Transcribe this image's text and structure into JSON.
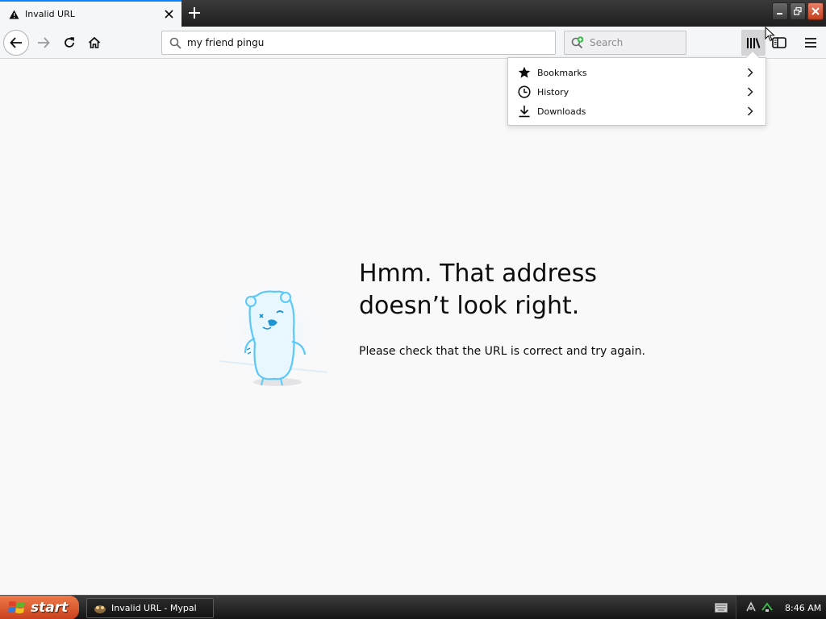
{
  "tab": {
    "title": "Invalid URL",
    "icon": "warning-icon"
  },
  "toolbar": {
    "url_value": "my friend pingu",
    "search_placeholder": "Search"
  },
  "library_panel": {
    "items": [
      {
        "label": "Bookmarks",
        "icon": "star-icon"
      },
      {
        "label": "History",
        "icon": "clock-icon"
      },
      {
        "label": "Downloads",
        "icon": "download-icon"
      }
    ]
  },
  "error": {
    "title_line1": "Hmm. That address",
    "title_line2": "doesn’t look right.",
    "description": "Please check that the URL is correct and try again."
  },
  "taskbar": {
    "start_label": "start",
    "task_label": "Invalid URL - Mypal",
    "clock": "8:46 AM"
  },
  "colors": {
    "accent": "#0a84ff",
    "start_button": "#d9572c",
    "illustration": "#5ac8fa"
  }
}
